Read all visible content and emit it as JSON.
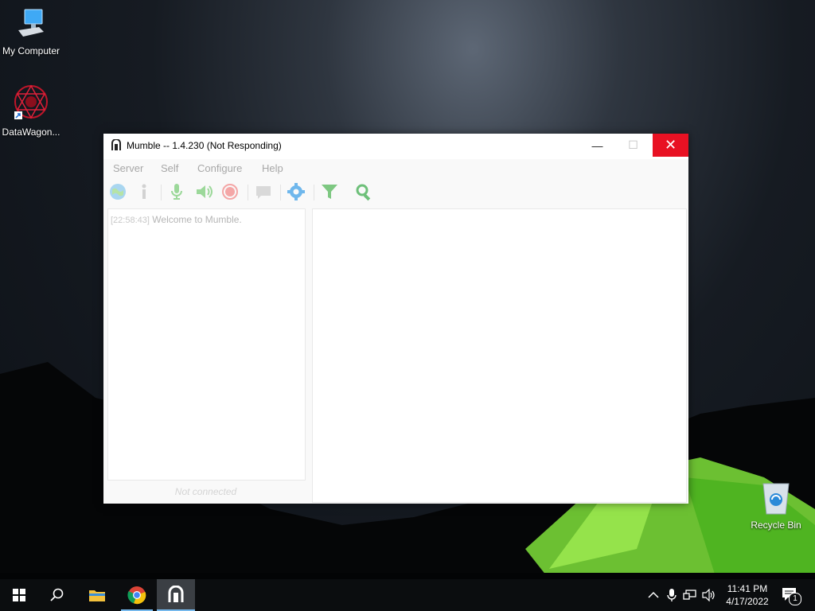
{
  "desktop": {
    "icons": [
      {
        "label": "My Computer",
        "icon": "computer-icon"
      },
      {
        "label": "DataWagon...",
        "icon": "datawagon-shortcut-icon"
      },
      {
        "label": "Recycle Bin",
        "icon": "recycle-bin-icon"
      }
    ]
  },
  "window": {
    "title": "Mumble -- 1.4.230 (Not Responding)",
    "controls": {
      "minimize": "—",
      "maximize": "☐",
      "close": "✕"
    },
    "menu": [
      "Server",
      "Self",
      "Configure",
      "Help"
    ],
    "toolbar": [
      "connect-globe-icon",
      "info-icon",
      "mute-microphone-icon",
      "deafen-speaker-icon",
      "record-icon",
      "comment-icon",
      "settings-gear-icon",
      "filter-icon",
      "search-icon"
    ],
    "log": {
      "timestamp": "[22:58:43]",
      "message": "Welcome to Mumble."
    },
    "chat_placeholder": "Not connected",
    "colors": {
      "close": "#e81123",
      "toolbar_green": "#5fbf63",
      "toolbar_blue": "#3fa0e6"
    }
  },
  "taskbar": {
    "apps": [
      "start-icon",
      "search-icon",
      "file-explorer-icon",
      "chrome-icon",
      "mumble-icon"
    ],
    "tray": [
      "chevron-up-icon",
      "microphone-icon",
      "network-icon",
      "volume-icon"
    ],
    "time": "11:41 PM",
    "date": "4/17/2022",
    "notification_count": "1"
  }
}
